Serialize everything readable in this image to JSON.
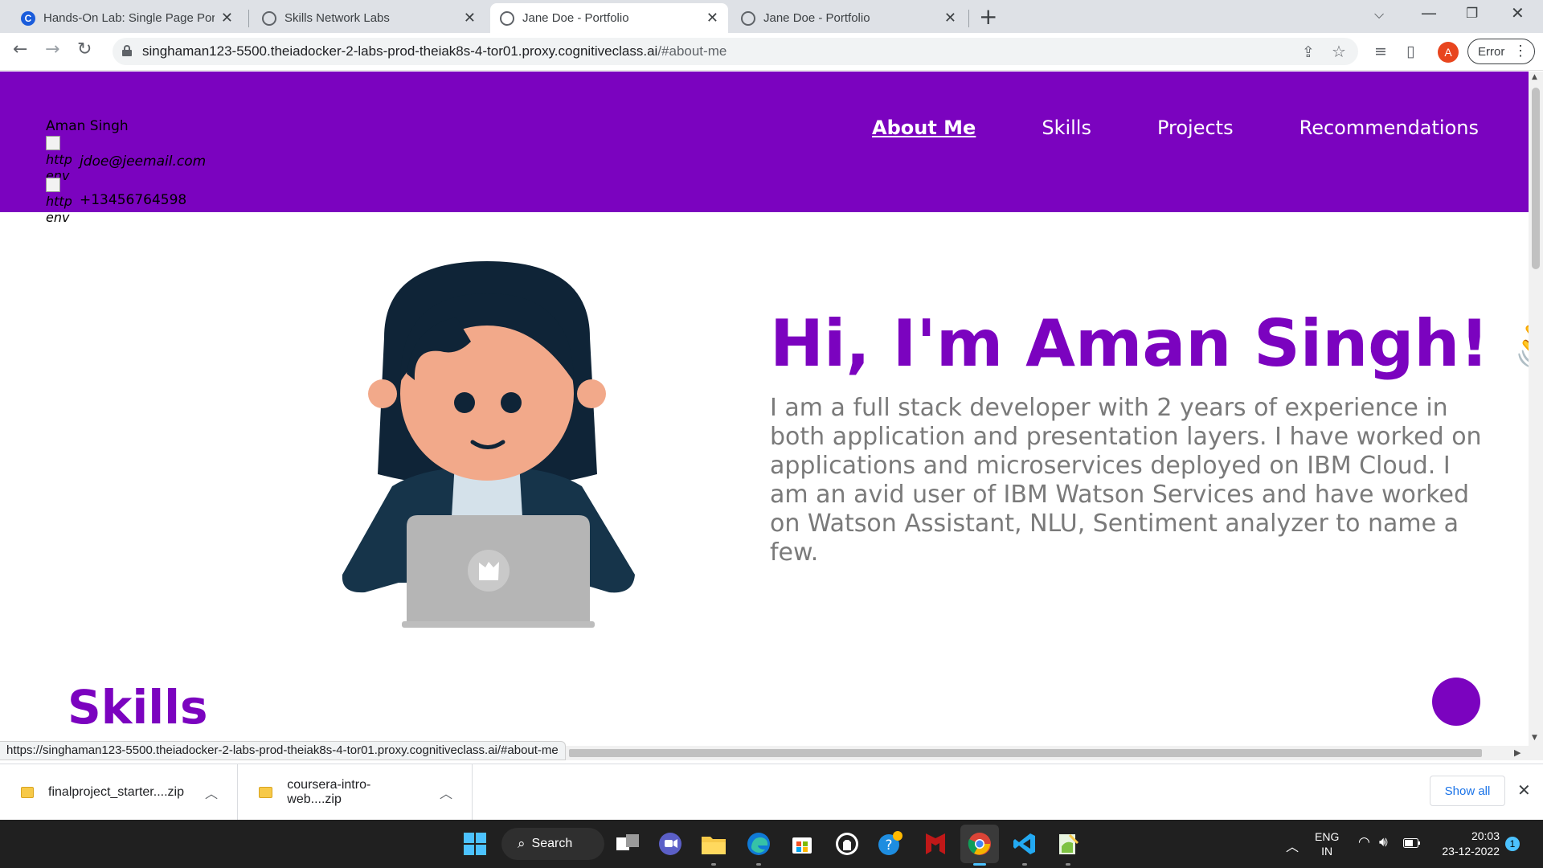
{
  "browser": {
    "tabs": [
      {
        "title": "Hands-On Lab: Single Page Portf",
        "active": false
      },
      {
        "title": "Skills Network Labs",
        "active": false
      },
      {
        "title": "Jane Doe - Portfolio",
        "active": true
      },
      {
        "title": "Jane Doe - Portfolio",
        "active": false
      }
    ],
    "url_host": "singhaman123-5500.theiadocker-2-labs-prod-theiak8s-4-tor01.proxy.cognitiveclass.ai",
    "url_path": "/#about-me",
    "profile_initial": "A",
    "error_label": "Error"
  },
  "page": {
    "contact": {
      "name": "Aman Singh",
      "broken_img_alt_1": "http env",
      "email": "jdoe@jeemail.com",
      "broken_img_alt_2": "http env",
      "phone": "+13456764598"
    },
    "nav": [
      {
        "label": "About Me",
        "active": true
      },
      {
        "label": "Skills",
        "active": false
      },
      {
        "label": "Projects",
        "active": false
      },
      {
        "label": "Recommendations",
        "active": false
      }
    ],
    "hero_title": "Hi, I'm Aman Singh! 👋",
    "hero_text": "I am a full stack developer with 2 years of experience in both application and presentation layers. I have worked on applications and microservices deployed on IBM Cloud. I am an avid user of IBM Watson Services and have worked on Watson Assistant, NLU, Sentiment analyzer to name a few.",
    "skills_heading": "Skills",
    "accent_color": "#7b03bf"
  },
  "status_url": "https://singhaman123-5500.theiadocker-2-labs-prod-theiak8s-4-tor01.proxy.cognitiveclass.ai/#about-me",
  "downloads": {
    "items": [
      {
        "name": "finalproject_starter....zip"
      },
      {
        "name": "coursera-intro-web....zip"
      }
    ],
    "show_all": "Show all"
  },
  "taskbar": {
    "search_label": "Search",
    "lang_top": "ENG",
    "lang_bottom": "IN",
    "time": "20:03",
    "date": "23-12-2022",
    "notification_count": "1"
  }
}
